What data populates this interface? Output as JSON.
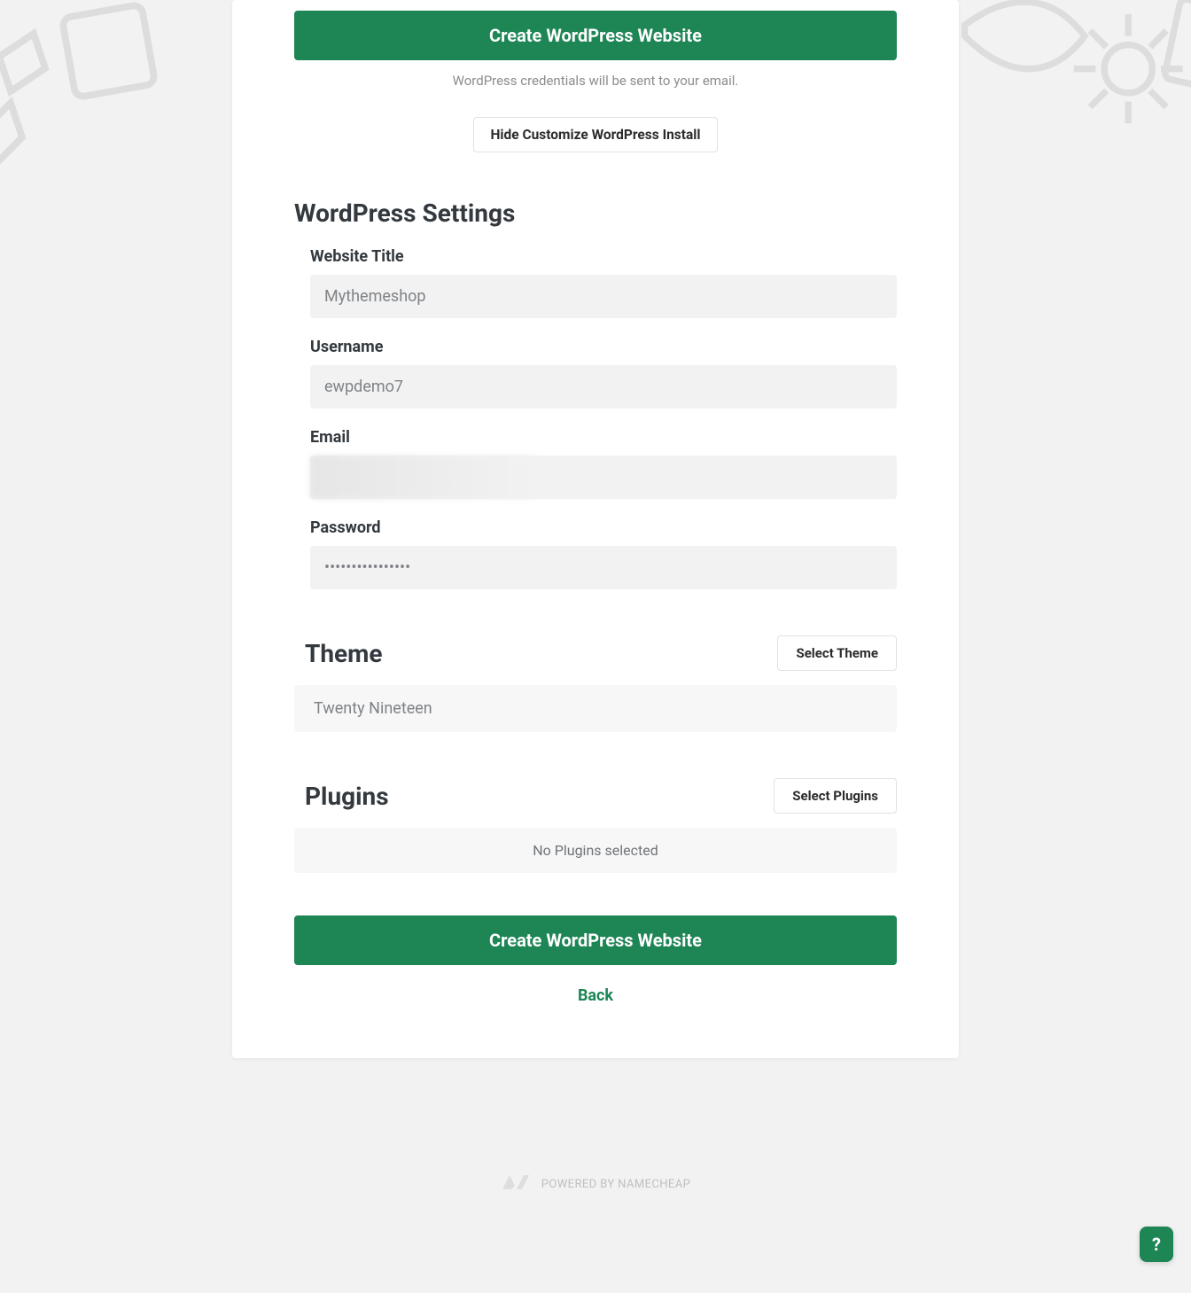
{
  "topBtn": "Create WordPress Website",
  "credNote": "WordPress credentials will be sent to your email.",
  "hideCustomize": "Hide Customize WordPress Install",
  "settings": {
    "title": "WordPress Settings",
    "fields": {
      "websiteTitle": {
        "label": "Website Title",
        "value": "Mythemeshop"
      },
      "username": {
        "label": "Username",
        "value": "ewpdemo7"
      },
      "email": {
        "label": "Email",
        "value": ""
      },
      "password": {
        "label": "Password",
        "value": "••••••••••••••••"
      }
    }
  },
  "theme": {
    "title": "Theme",
    "selectBtn": "Select Theme",
    "current": "Twenty Nineteen"
  },
  "plugins": {
    "title": "Plugins",
    "selectBtn": "Select Plugins",
    "current": "No Plugins selected"
  },
  "bottomBtn": "Create WordPress Website",
  "back": "Back",
  "footer": "POWERED BY NAMECHEAP",
  "helpIcon": "?"
}
